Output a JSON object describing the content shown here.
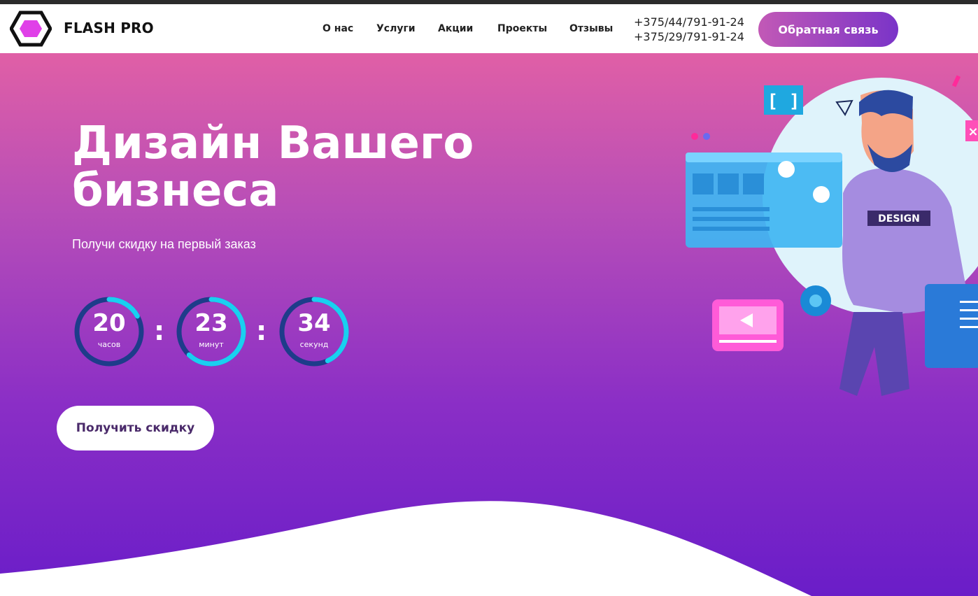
{
  "header": {
    "logo_text": "FLASH PRO",
    "nav": [
      {
        "label": "О нас"
      },
      {
        "label": "Услуги"
      },
      {
        "label": "Акции"
      },
      {
        "label": "Проекты"
      },
      {
        "label": "Отзывы"
      }
    ],
    "phones": [
      "+375/44/791-91-24",
      "+375/29/791-91-24"
    ],
    "callback_label": "Обратная связь"
  },
  "hero": {
    "title_line1": "Дизайн Вашего",
    "title_line2": "бизнеса",
    "subtitle": "Получи скидку на первый заказ",
    "timer": [
      {
        "value": "20",
        "unit": "часов",
        "progress": 0.17
      },
      {
        "value": "23",
        "unit": "минут",
        "progress": 0.62
      },
      {
        "value": "34",
        "unit": "секунд",
        "progress": 0.43
      }
    ],
    "separator": ":",
    "discount_button": "Получить скидку",
    "illustration_badge": "DESIGN"
  },
  "colors": {
    "accent_gradient_start": "#c259b6",
    "accent_gradient_end": "#7a34c8",
    "timer_ring_track": "#1e3c8a",
    "timer_ring_progress": "#19d0f0"
  }
}
